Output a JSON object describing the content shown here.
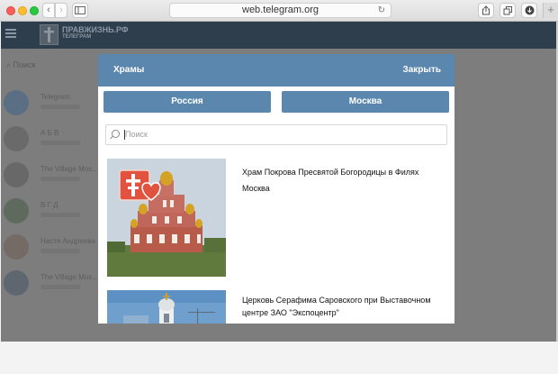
{
  "browser": {
    "url": "web.telegram.org"
  },
  "telegram": {
    "logo_title": "ПРАВЖИЗНЬ.РФ",
    "logo_subtitle": "ТЕЛЕГРАМ",
    "search_placeholder": "Поиск",
    "chats": [
      {
        "name": "Telegram"
      },
      {
        "name": "А Б В"
      },
      {
        "name": "The Village Mos..."
      },
      {
        "name": "В Г Д"
      },
      {
        "name": "Настя Андреева"
      },
      {
        "name": "The Village Mos..."
      }
    ]
  },
  "modal": {
    "title": "Храмы",
    "close_label": "Закрыть",
    "country_button": "Россия",
    "city_button": "Москва",
    "search_placeholder": "Поиск",
    "churches": [
      {
        "name": "Храм Покрова Пресвятой Богородицы в Филях",
        "city": "Москва"
      },
      {
        "name": "Церковь Серафима Саровского при Выставочном центре ЗАО \"Экспоцентр\"",
        "city": ""
      }
    ]
  }
}
